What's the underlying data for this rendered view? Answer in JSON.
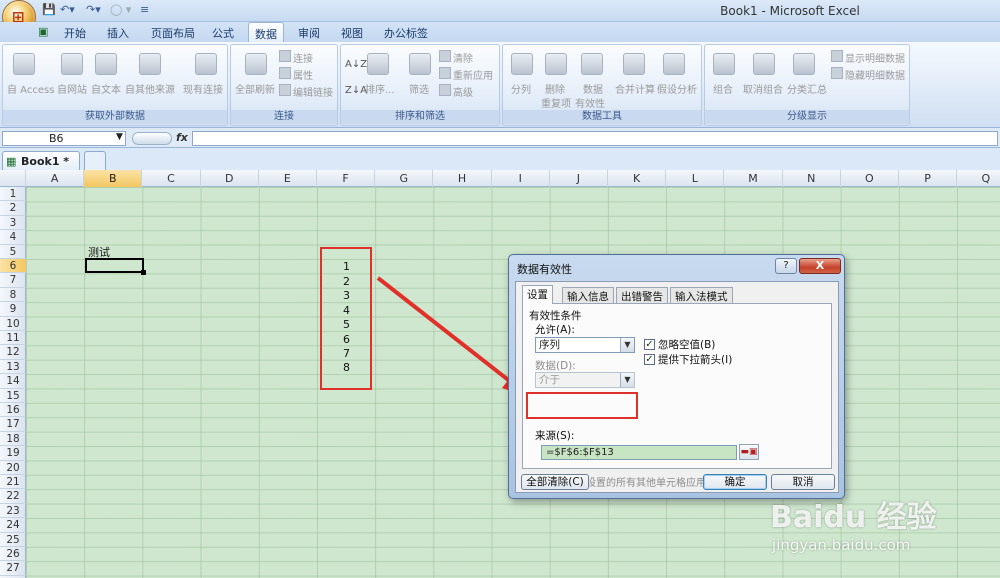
{
  "window": {
    "title": "Book1 - Microsoft Excel"
  },
  "ribbon": {
    "tabs": [
      "开始",
      "插入",
      "页面布局",
      "公式",
      "数据",
      "审阅",
      "视图",
      "办公标签"
    ],
    "active_tab": "数据",
    "groups": {
      "external": {
        "label": "获取外部数据",
        "items": [
          "自 Access",
          "自网站",
          "自文本",
          "自其他来源",
          "现有连接"
        ]
      },
      "connections": {
        "label": "连接",
        "big": "全部刷新",
        "items": [
          "连接",
          "属性",
          "编辑链接"
        ]
      },
      "sort": {
        "label": "排序和筛选",
        "sort": "排序...",
        "filter": "筛选",
        "items": [
          "清除",
          "重新应用",
          "高级"
        ]
      },
      "tools": {
        "label": "数据工具",
        "split": "分列",
        "dup_1": "删除",
        "dup_2": "重复项",
        "valid_1": "数据",
        "valid_2": "有效性",
        "merge": "合并计算",
        "whatif": "假设分析"
      },
      "outline": {
        "label": "分级显示",
        "group": "组合",
        "ungroup": "取消组合",
        "subtotal": "分类汇总",
        "show": "显示明细数据",
        "hide": "隐藏明细数据"
      }
    }
  },
  "formula_bar": {
    "name_box": "B6",
    "fx": "fx",
    "formula": ""
  },
  "workbook_tab": {
    "label": "Book1 *"
  },
  "sheet": {
    "columns": [
      "A",
      "B",
      "C",
      "D",
      "E",
      "F",
      "G",
      "H",
      "I",
      "J",
      "K",
      "L",
      "M",
      "N",
      "O",
      "P",
      "Q"
    ],
    "rows": [
      "1",
      "2",
      "3",
      "4",
      "5",
      "6",
      "7",
      "8",
      "9",
      "10",
      "11",
      "12",
      "13",
      "14",
      "15",
      "16",
      "17",
      "18",
      "19",
      "20",
      "21",
      "22",
      "23",
      "24",
      "25",
      "26",
      "27"
    ],
    "selected_column": "B",
    "selected_row": "6",
    "cells": {
      "B5": "测试",
      "F6": "1",
      "F7": "2",
      "F8": "3",
      "F9": "4",
      "F10": "5",
      "F11": "6",
      "F12": "7",
      "F13": "8"
    }
  },
  "dialog": {
    "title": "数据有效性",
    "help": "?",
    "close": "X",
    "tabs": [
      "设置",
      "输入信息",
      "出错警告",
      "输入法模式"
    ],
    "active_tab": "设置",
    "section_title": "有效性条件",
    "allow_label": "允许(A):",
    "allow_value": "序列",
    "data_label": "数据(D):",
    "data_value": "介于",
    "ignore_blank": {
      "label": "忽略空值(B)",
      "checked": true
    },
    "dropdown": {
      "label": "提供下拉箭头(I)",
      "checked": true
    },
    "source_label": "来源(S):",
    "source_value": "=$F$6:$F$13",
    "apply_all": {
      "label": "对有同样设置的所有其他单元格应用这些更改(P)",
      "checked": false
    },
    "clear_all": "全部清除(C)",
    "ok": "确定",
    "cancel": "取消"
  },
  "watermark": {
    "brand": "Baidu 经验",
    "url": "jingyan.baidu.com"
  },
  "colors": {
    "sheet_bg": "#cfe7cf",
    "highlight_box": "#e0302a",
    "arrow": "#e0302a",
    "source_input_bg": "#c7e4c3"
  }
}
